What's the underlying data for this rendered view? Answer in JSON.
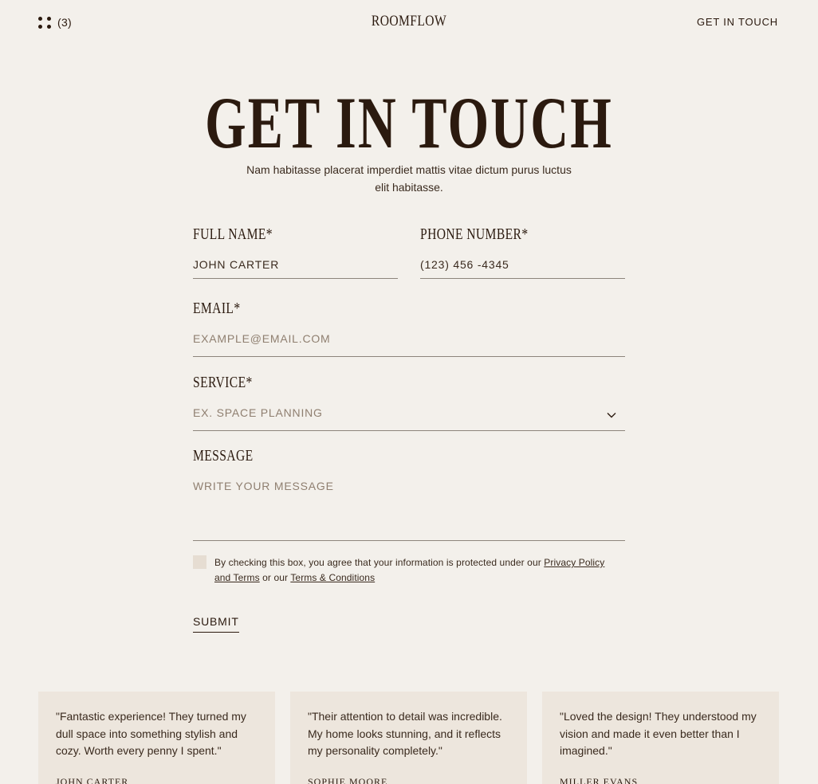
{
  "header": {
    "menu_count": "(3)",
    "logo": "ROOMFLOW",
    "cta": "GET IN TOUCH"
  },
  "hero": {
    "title": "GET IN TOUCH",
    "subtitle": "Nam habitasse placerat imperdiet mattis vitae dictum purus luctus elit habitasse."
  },
  "form": {
    "full_name": {
      "label": "FULL NAME*",
      "value": "JOHN CARTER"
    },
    "phone": {
      "label": "PHONE NUMBER*",
      "value": "(123) 456 -4345"
    },
    "email": {
      "label": "EMAIL*",
      "placeholder": "EXAMPLE@EMAIL.COM"
    },
    "service": {
      "label": "SERVICE*",
      "placeholder": "EX. SPACE PLANNING",
      "icon": "chevron-down-icon"
    },
    "message": {
      "label": "MESSAGE",
      "placeholder": "WRITE YOUR MESSAGE"
    },
    "consent": {
      "text_before": "By checking this box, you agree that your information is protected under our ",
      "link1": "Privacy Policy and Terms",
      "text_middle": " or our ",
      "link2": "Terms & Conditions"
    },
    "submit": "SUBMIT"
  },
  "testimonials": [
    {
      "quote": "\"Fantastic experience! They turned my dull space into something stylish and cozy. Worth every penny I spent.\"",
      "author": "JOHN CARTER"
    },
    {
      "quote": "\"Their attention to detail was incredible. My home looks stunning, and it reflects my personality completely.\"",
      "author": "SOPHIE MOORE"
    },
    {
      "quote": "\"Loved the design! They understood my vision and made it even better than I imagined.\"",
      "author": "MILLER EVANS"
    }
  ],
  "colors": {
    "background": "#f3f0eb",
    "text": "#2b1a0f",
    "card": "#ede6dd",
    "checkbox": "#e6ddd2"
  }
}
